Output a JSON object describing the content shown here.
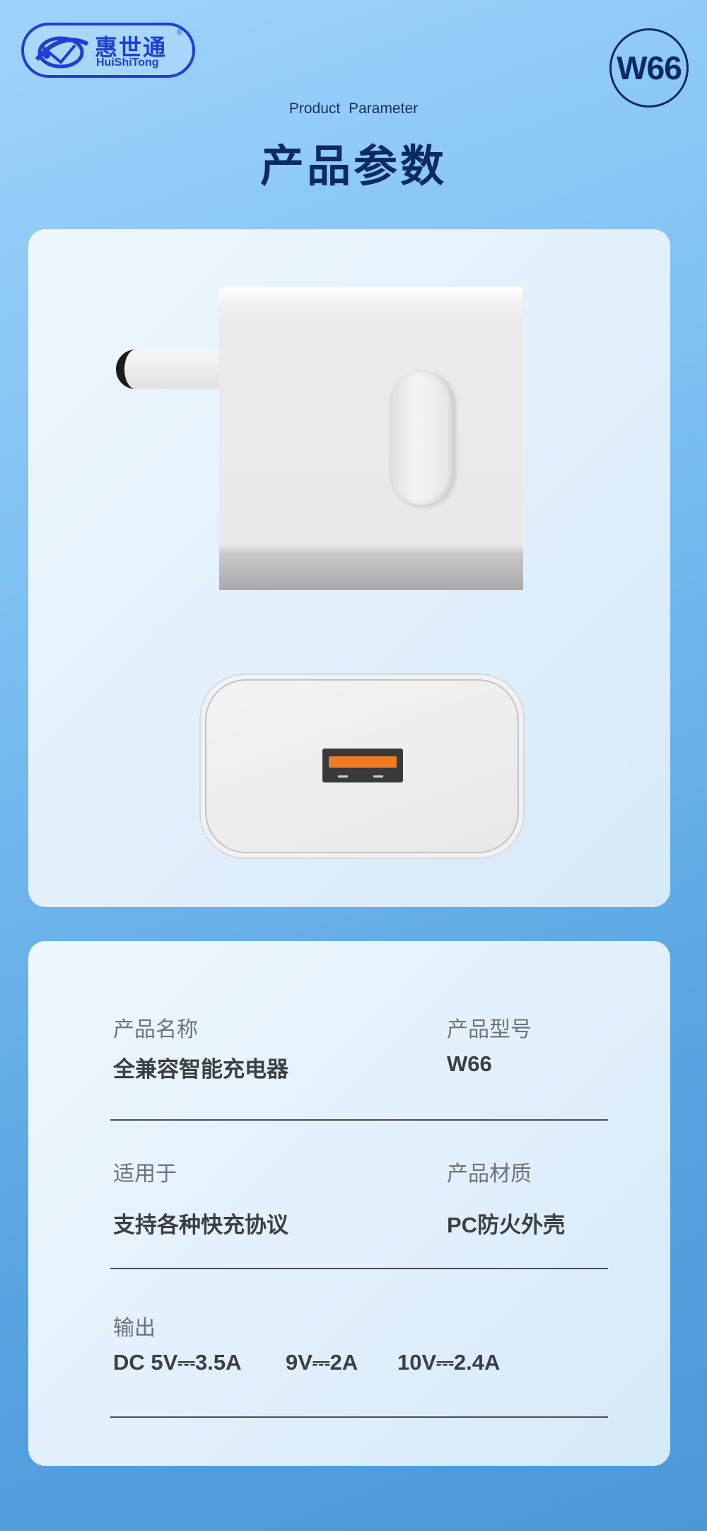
{
  "brand": {
    "name_cn": "惠世通",
    "name_en": "HuiShiTong",
    "registered": "®"
  },
  "model_badge": "W66",
  "header": {
    "subtitle": "Product  Parameter",
    "title": "产品参数"
  },
  "colors": {
    "accent": "#0c2a63",
    "brand": "#1e3fd6",
    "port": "#f07b22"
  },
  "specs": {
    "product_name": {
      "label": "产品名称",
      "value": "全兼容智能充电器"
    },
    "product_model": {
      "label": "产品型号",
      "value": "W66"
    },
    "applicable": {
      "label": "适用于",
      "value": "支持各种快充协议"
    },
    "material": {
      "label": "产品材质",
      "value": "PC防火外壳"
    },
    "output": {
      "label": "输出",
      "values": [
        "DC 5V⎓3.5A",
        "9V⎓2A",
        "10V⎓2.4A"
      ]
    }
  }
}
